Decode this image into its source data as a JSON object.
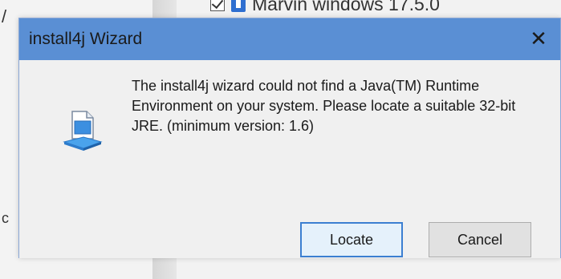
{
  "background": {
    "item_label": "Marvin windows 17.5.0",
    "left_fragment_top": "/",
    "left_fragment_bottom": "c"
  },
  "dialog": {
    "title": "install4j Wizard",
    "close_symbol": "✕",
    "message": "The install4j wizard could not find a Java(TM) Runtime Environment on your system. Please locate a suitable 32-bit JRE. (minimum version: 1.6)",
    "buttons": {
      "locate": "Locate",
      "cancel": "Cancel"
    },
    "icon": "installer-document-icon"
  },
  "colors": {
    "titlebar": "#5a8fd4",
    "focus_border": "#3c7fd1",
    "dialog_bg": "#f0f0f0"
  }
}
